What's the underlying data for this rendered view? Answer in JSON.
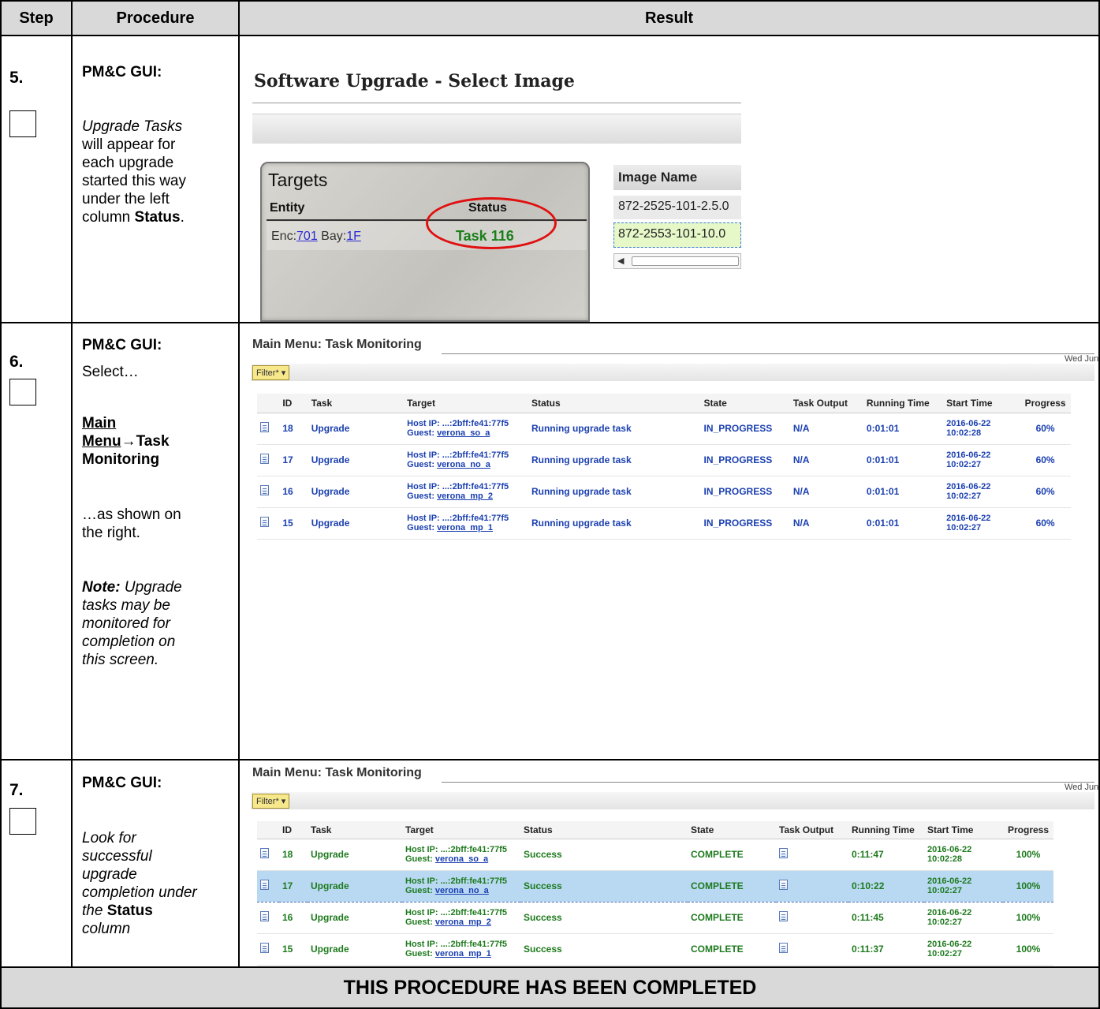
{
  "header": {
    "step": "Step",
    "procedure": "Procedure",
    "result": "Result"
  },
  "step5": {
    "num": "5.",
    "proc_title": "PM&C GUI:",
    "proc_l1_i": "Upgrade Tasks",
    "proc_l2": "will appear for",
    "proc_l3": "each upgrade",
    "proc_l4": "started this way",
    "proc_l5": "under the left",
    "proc_l6a": "column ",
    "proc_l6b": "Status",
    "proc_l6c": ".",
    "screen": {
      "title": "Software Upgrade - Select Image",
      "targets_title": "Targets",
      "col_entity": "Entity",
      "col_status": "Status",
      "enc_label": "Enc:",
      "enc_value": "701",
      "bay_label": " Bay:",
      "bay_value": "1F",
      "status_value": "Task 116",
      "image_header": "Image Name",
      "image_row1": "872-2525-101-2.5.0",
      "image_row2": "872-2553-101-10.0"
    }
  },
  "step6": {
    "num": "6.",
    "proc_title": "PM&C GUI:",
    "select": "Select…",
    "menu_a": "Main",
    "menu_b": "Menu",
    "menu_arrow": "→",
    "menu_c": "Task",
    "menu_d": "Monitoring",
    "shown1": "…as shown on",
    "shown2": "the right.",
    "note_b": "Note:",
    "note_1": " Upgrade",
    "note_2": "tasks may be",
    "note_3": "monitored for",
    "note_4": "completion on",
    "note_5": "this screen.",
    "screen": {
      "title": "Main Menu: Task Monitoring",
      "date": "Wed Jun",
      "filter": "Filter* ▾",
      "columns": [
        "",
        "ID",
        "Task",
        "Target",
        "Status",
        "State",
        "Task Output",
        "Running Time",
        "Start Time",
        "Progress"
      ],
      "rows": [
        {
          "id": "18",
          "task": "Upgrade",
          "host": "Host IP: ...:2bff:fe41:77f5",
          "guest_label": "Guest: ",
          "guest": "verona_so_a",
          "status": "Running upgrade task",
          "state": "IN_PROGRESS",
          "output": "N/A",
          "running": "0:01:01",
          "start1": "2016-06-22",
          "start2": "10:02:28",
          "progress": "60%"
        },
        {
          "id": "17",
          "task": "Upgrade",
          "host": "Host IP: ...:2bff:fe41:77f5",
          "guest_label": "Guest: ",
          "guest": "verona_no_a",
          "status": "Running upgrade task",
          "state": "IN_PROGRESS",
          "output": "N/A",
          "running": "0:01:01",
          "start1": "2016-06-22",
          "start2": "10:02:27",
          "progress": "60%"
        },
        {
          "id": "16",
          "task": "Upgrade",
          "host": "Host IP: ...:2bff:fe41:77f5",
          "guest_label": "Guest: ",
          "guest": "verona_mp_2",
          "status": "Running upgrade task",
          "state": "IN_PROGRESS",
          "output": "N/A",
          "running": "0:01:01",
          "start1": "2016-06-22",
          "start2": "10:02:27",
          "progress": "60%"
        },
        {
          "id": "15",
          "task": "Upgrade",
          "host": "Host IP: ...:2bff:fe41:77f5",
          "guest_label": "Guest: ",
          "guest": "verona_mp_1",
          "status": "Running upgrade task",
          "state": "IN_PROGRESS",
          "output": "N/A",
          "running": "0:01:01",
          "start1": "2016-06-22",
          "start2": "10:02:27",
          "progress": "60%"
        }
      ]
    }
  },
  "step7": {
    "num": "7.",
    "proc_title": "PM&C GUI:",
    "l1": "Look for",
    "l2": "successful",
    "l3": "upgrade",
    "l4": "completion under",
    "l5a": "the ",
    "l5b": "Status",
    "l6": "column",
    "screen": {
      "title": "Main Menu: Task Monitoring",
      "date": "Wed Jun",
      "filter": "Filter* ▾",
      "columns": [
        "",
        "ID",
        "Task",
        "Target",
        "Status",
        "State",
        "Task Output",
        "Running Time",
        "Start Time",
        "Progress"
      ],
      "rows": [
        {
          "id": "18",
          "task": "Upgrade",
          "host": "Host IP: ...:2bff:fe41:77f5",
          "guest_label": "Guest: ",
          "guest": "verona_so_a",
          "status": "Success",
          "state": "COMPLETE",
          "running": "0:11:47",
          "start1": "2016-06-22",
          "start2": "10:02:28",
          "progress": "100%"
        },
        {
          "id": "17",
          "task": "Upgrade",
          "host": "Host IP: ...:2bff:fe41:77f5",
          "guest_label": "Guest: ",
          "guest": "verona_no_a",
          "status": "Success",
          "state": "COMPLETE",
          "running": "0:10:22",
          "start1": "2016-06-22",
          "start2": "10:02:27",
          "progress": "100%"
        },
        {
          "id": "16",
          "task": "Upgrade",
          "host": "Host IP: ...:2bff:fe41:77f5",
          "guest_label": "Guest: ",
          "guest": "verona_mp_2",
          "status": "Success",
          "state": "COMPLETE",
          "running": "0:11:45",
          "start1": "2016-06-22",
          "start2": "10:02:27",
          "progress": "100%"
        },
        {
          "id": "15",
          "task": "Upgrade",
          "host": "Host IP: ...:2bff:fe41:77f5",
          "guest_label": "Guest: ",
          "guest": "verona_mp_1",
          "status": "Success",
          "state": "COMPLETE",
          "running": "0:11:37",
          "start1": "2016-06-22",
          "start2": "10:02:27",
          "progress": "100%"
        }
      ]
    }
  },
  "footer": "THIS PROCEDURE HAS BEEN COMPLETED"
}
